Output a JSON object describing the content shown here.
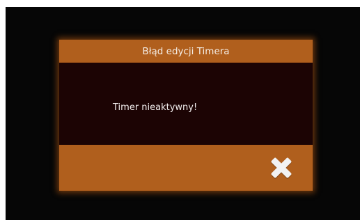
{
  "dialog": {
    "title": "Błąd edycji Timera",
    "message": "Timer nieaktywny!",
    "close_icon": "close-icon"
  },
  "colors": {
    "screen_background": "#060606",
    "header_footer": "#b05f1d",
    "body_background": "#1c0404",
    "glow": "#be5f14",
    "text": "#f4ece4"
  }
}
